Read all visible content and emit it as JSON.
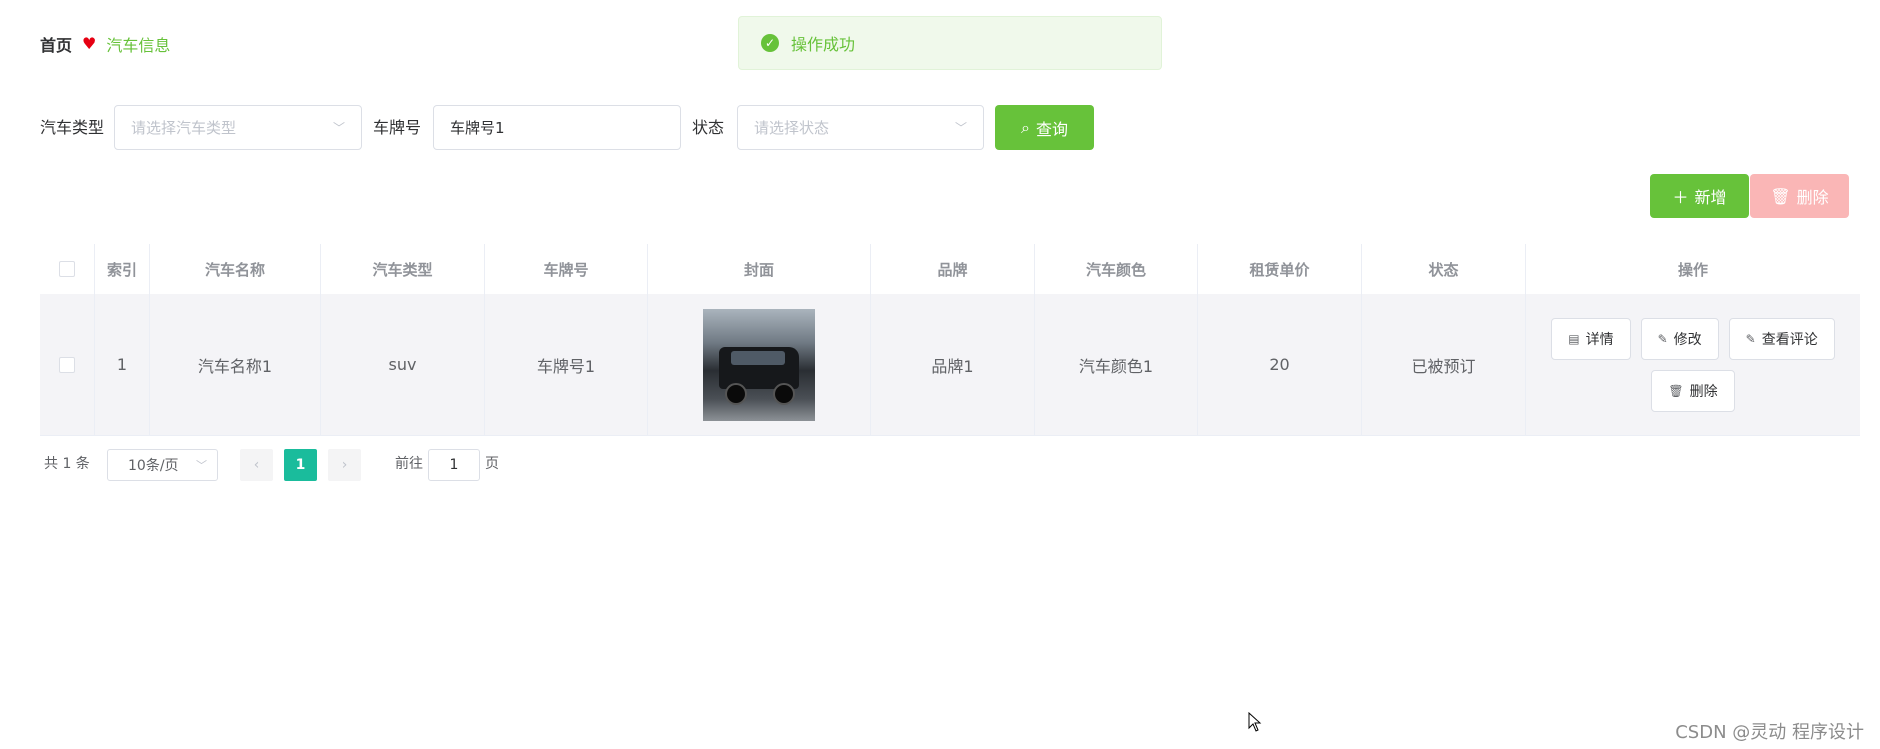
{
  "breadcrumb": {
    "home": "首页",
    "current": "汽车信息"
  },
  "toast": {
    "message": "操作成功"
  },
  "search": {
    "type_label": "汽车类型",
    "type_placeholder": "请选择汽车类型",
    "plate_label": "车牌号",
    "plate_value": "车牌号1",
    "status_label": "状态",
    "status_placeholder": "请选择状态",
    "query_label": "查询"
  },
  "toolbar": {
    "add_label": "新增",
    "delete_label": "删除"
  },
  "table": {
    "headers": [
      "索引",
      "汽车名称",
      "汽车类型",
      "车牌号",
      "封面",
      "品牌",
      "汽车颜色",
      "租赁单价",
      "状态",
      "操作"
    ],
    "rows": [
      {
        "index": "1",
        "name": "汽车名称1",
        "type": "suv",
        "plate": "车牌号1",
        "brand": "品牌1",
        "color": "汽车颜色1",
        "price": "20",
        "status": "已被预订"
      }
    ],
    "ops": {
      "detail": "详情",
      "edit": "修改",
      "comments": "查看评论",
      "delete": "删除"
    }
  },
  "pagination": {
    "total": "共 1 条",
    "page_size": "10条/页",
    "current_page": "1",
    "goto_label": "前往",
    "goto_value": "1",
    "goto_unit": "页"
  },
  "watermark": "CSDN @灵动 程序设计",
  "colors": {
    "primary": "#67c23a",
    "danger_light": "#fab6b6",
    "pager_active": "#1abc9c"
  }
}
